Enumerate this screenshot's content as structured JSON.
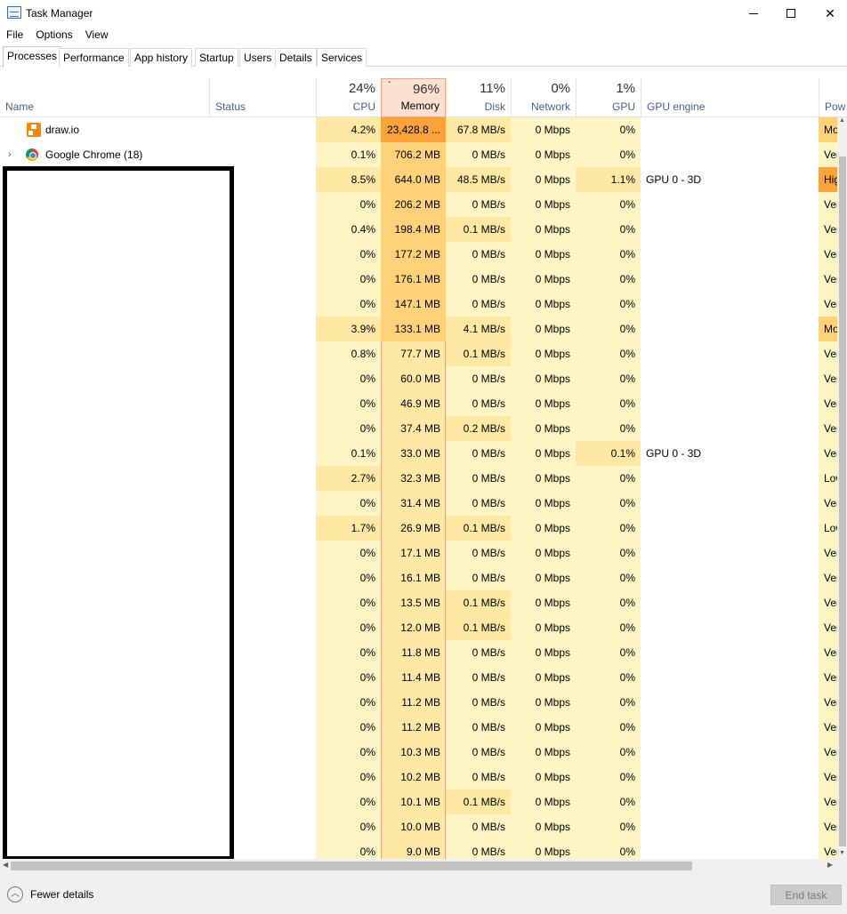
{
  "window": {
    "title": "Task Manager",
    "icon": "task-manager-icon"
  },
  "menu": [
    "File",
    "Options",
    "View"
  ],
  "tabs": [
    "Processes",
    "Performance",
    "App history",
    "Startup",
    "Users",
    "Details",
    "Services"
  ],
  "active_tab": "Processes",
  "columns": {
    "name": "Name",
    "status": "Status",
    "cpu": {
      "pct": "24%",
      "label": "CPU"
    },
    "memory": {
      "pct": "96%",
      "label": "Memory"
    },
    "disk": {
      "pct": "11%",
      "label": "Disk"
    },
    "network": {
      "pct": "0%",
      "label": "Network"
    },
    "gpu": {
      "pct": "1%",
      "label": "GPU"
    },
    "gpu_engine": "GPU engine",
    "power": "Pow"
  },
  "rows": [
    {
      "name": "draw.io",
      "cpu": "4.2%",
      "mem": "23,428.8 ...",
      "disk": "67.8 MB/s",
      "net": "0 Mbps",
      "gpu": "0%",
      "engine": "",
      "power": "Mo"
    },
    {
      "name": "Google Chrome (18)",
      "cpu": "0.1%",
      "mem": "706.2 MB",
      "disk": "0 MB/s",
      "net": "0 Mbps",
      "gpu": "0%",
      "engine": "",
      "power": "Ver"
    },
    {
      "name": "",
      "cpu": "8.5%",
      "mem": "644.0 MB",
      "disk": "48.5 MB/s",
      "net": "0 Mbps",
      "gpu": "1.1%",
      "engine": "GPU 0 - 3D",
      "power": "Hig"
    },
    {
      "name": "",
      "cpu": "0%",
      "mem": "206.2 MB",
      "disk": "0 MB/s",
      "net": "0 Mbps",
      "gpu": "0%",
      "engine": "",
      "power": "Ver"
    },
    {
      "name": "",
      "cpu": "0.4%",
      "mem": "198.4 MB",
      "disk": "0.1 MB/s",
      "net": "0 Mbps",
      "gpu": "0%",
      "engine": "",
      "power": "Ver"
    },
    {
      "name": "",
      "cpu": "0%",
      "mem": "177.2 MB",
      "disk": "0 MB/s",
      "net": "0 Mbps",
      "gpu": "0%",
      "engine": "",
      "power": "Ver"
    },
    {
      "name": "",
      "cpu": "0%",
      "mem": "176.1 MB",
      "disk": "0 MB/s",
      "net": "0 Mbps",
      "gpu": "0%",
      "engine": "",
      "power": "Ver"
    },
    {
      "name": "",
      "cpu": "0%",
      "mem": "147.1 MB",
      "disk": "0 MB/s",
      "net": "0 Mbps",
      "gpu": "0%",
      "engine": "",
      "power": "Ver"
    },
    {
      "name": "",
      "cpu": "3.9%",
      "mem": "133.1 MB",
      "disk": "4.1 MB/s",
      "net": "0 Mbps",
      "gpu": "0%",
      "engine": "",
      "power": "Mo"
    },
    {
      "name": "",
      "cpu": "0.8%",
      "mem": "77.7 MB",
      "disk": "0.1 MB/s",
      "net": "0 Mbps",
      "gpu": "0%",
      "engine": "",
      "power": "Ver"
    },
    {
      "name": "",
      "cpu": "0%",
      "mem": "60.0 MB",
      "disk": "0 MB/s",
      "net": "0 Mbps",
      "gpu": "0%",
      "engine": "",
      "power": "Ver"
    },
    {
      "name": "",
      "cpu": "0%",
      "mem": "46.9 MB",
      "disk": "0 MB/s",
      "net": "0 Mbps",
      "gpu": "0%",
      "engine": "",
      "power": "Ver"
    },
    {
      "name": "",
      "cpu": "0%",
      "mem": "37.4 MB",
      "disk": "0.2 MB/s",
      "net": "0 Mbps",
      "gpu": "0%",
      "engine": "",
      "power": "Ver"
    },
    {
      "name": "",
      "cpu": "0.1%",
      "mem": "33.0 MB",
      "disk": "0 MB/s",
      "net": "0 Mbps",
      "gpu": "0.1%",
      "engine": "GPU 0 - 3D",
      "power": "Ver"
    },
    {
      "name": "",
      "cpu": "2.7%",
      "mem": "32.3 MB",
      "disk": "0 MB/s",
      "net": "0 Mbps",
      "gpu": "0%",
      "engine": "",
      "power": "Low"
    },
    {
      "name": "",
      "cpu": "0%",
      "mem": "31.4 MB",
      "disk": "0 MB/s",
      "net": "0 Mbps",
      "gpu": "0%",
      "engine": "",
      "power": "Ver"
    },
    {
      "name": "",
      "cpu": "1.7%",
      "mem": "26.9 MB",
      "disk": "0.1 MB/s",
      "net": "0 Mbps",
      "gpu": "0%",
      "engine": "",
      "power": "Low"
    },
    {
      "name": "",
      "cpu": "0%",
      "mem": "17.1 MB",
      "disk": "0 MB/s",
      "net": "0 Mbps",
      "gpu": "0%",
      "engine": "",
      "power": "Ver"
    },
    {
      "name": "",
      "cpu": "0%",
      "mem": "16.1 MB",
      "disk": "0 MB/s",
      "net": "0 Mbps",
      "gpu": "0%",
      "engine": "",
      "power": "Ver"
    },
    {
      "name": "",
      "cpu": "0%",
      "mem": "13.5 MB",
      "disk": "0.1 MB/s",
      "net": "0 Mbps",
      "gpu": "0%",
      "engine": "",
      "power": "Ver"
    },
    {
      "name": "",
      "cpu": "0%",
      "mem": "12.0 MB",
      "disk": "0.1 MB/s",
      "net": "0 Mbps",
      "gpu": "0%",
      "engine": "",
      "power": "Ver"
    },
    {
      "name": "",
      "cpu": "0%",
      "mem": "11.8 MB",
      "disk": "0 MB/s",
      "net": "0 Mbps",
      "gpu": "0%",
      "engine": "",
      "power": "Ver"
    },
    {
      "name": "",
      "cpu": "0%",
      "mem": "11.4 MB",
      "disk": "0 MB/s",
      "net": "0 Mbps",
      "gpu": "0%",
      "engine": "",
      "power": "Ver"
    },
    {
      "name": "",
      "cpu": "0%",
      "mem": "11.2 MB",
      "disk": "0 MB/s",
      "net": "0 Mbps",
      "gpu": "0%",
      "engine": "",
      "power": "Ver"
    },
    {
      "name": "",
      "cpu": "0%",
      "mem": "11.2 MB",
      "disk": "0 MB/s",
      "net": "0 Mbps",
      "gpu": "0%",
      "engine": "",
      "power": "Ver"
    },
    {
      "name": "",
      "cpu": "0%",
      "mem": "10.3 MB",
      "disk": "0 MB/s",
      "net": "0 Mbps",
      "gpu": "0%",
      "engine": "",
      "power": "Ver"
    },
    {
      "name": "",
      "cpu": "0%",
      "mem": "10.2 MB",
      "disk": "0 MB/s",
      "net": "0 Mbps",
      "gpu": "0%",
      "engine": "",
      "power": "Ver"
    },
    {
      "name": "",
      "cpu": "0%",
      "mem": "10.1 MB",
      "disk": "0.1 MB/s",
      "net": "0 Mbps",
      "gpu": "0%",
      "engine": "",
      "power": "Ver"
    },
    {
      "name": "",
      "cpu": "0%",
      "mem": "10.0 MB",
      "disk": "0 MB/s",
      "net": "0 Mbps",
      "gpu": "0%",
      "engine": "",
      "power": "Ver"
    },
    {
      "name": "",
      "cpu": "0%",
      "mem": "9.0 MB",
      "disk": "0 MB/s",
      "net": "0 Mbps",
      "gpu": "0%",
      "engine": "",
      "power": "Ver"
    }
  ],
  "footer": {
    "fewer_details": "Fewer details",
    "end_task": "End task"
  },
  "colors": {
    "heat_light": "#fff4c4",
    "heat_mid": "#ffe8a3",
    "heat_high": "#ffd27a",
    "heat_hot": "#f9a33a",
    "mem_header": "#fde0cf"
  }
}
